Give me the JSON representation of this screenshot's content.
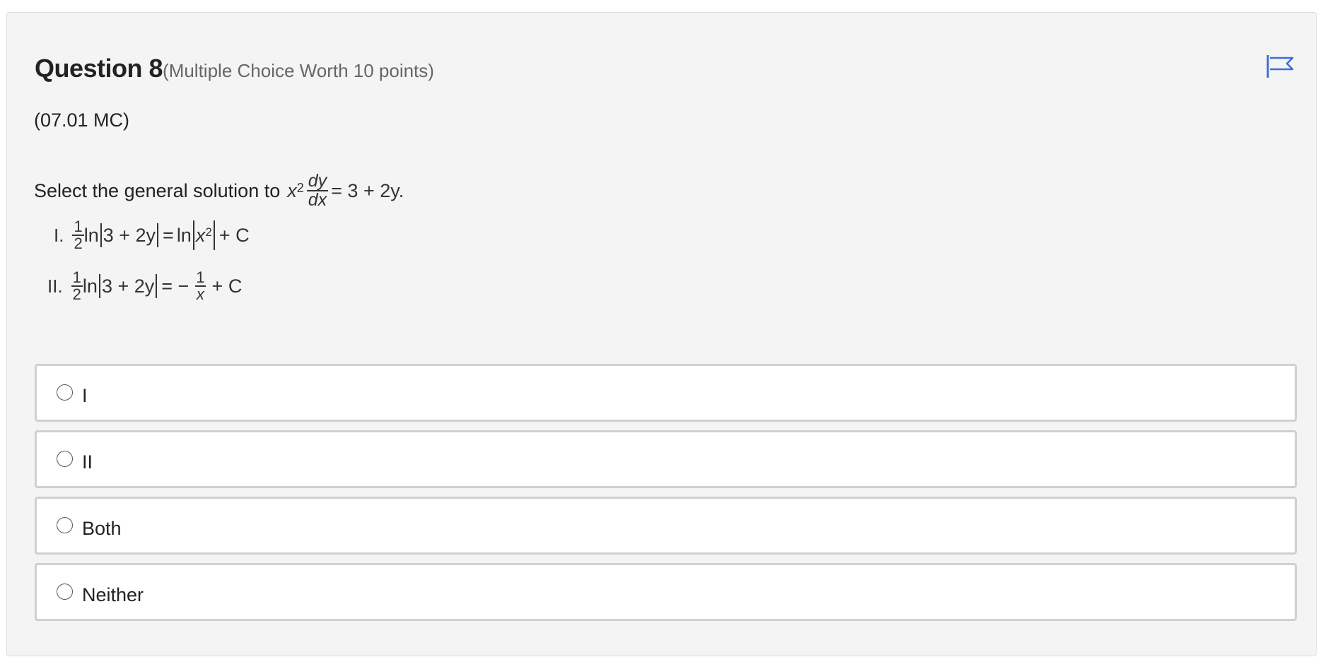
{
  "question": {
    "title": "Question 8",
    "meta": "(Multiple Choice Worth 10 points)",
    "code": "(07.01 MC)",
    "prompt": "Select the general solution to",
    "flag_icon": "flag-icon",
    "equation": {
      "base": "x",
      "exponent": "2",
      "frac_num": "dy",
      "frac_den": "dx",
      "rhs": "= 3 + 2y."
    }
  },
  "statements": [
    {
      "label": "I.",
      "coef_num": "1",
      "coef_den": "2",
      "ln_left": "ln",
      "abs_left": "3 + 2y",
      "equals": "=",
      "ln_right": "ln",
      "abs_right_base": "x",
      "abs_right_exp": "2",
      "tail": "+ C"
    },
    {
      "label": "II.",
      "coef_num": "1",
      "coef_den": "2",
      "ln_left": "ln",
      "abs_left": "3 + 2y",
      "equals": "= −",
      "frac_num": "1",
      "frac_den": "x",
      "tail": "+ C"
    }
  ],
  "options": [
    {
      "label": "I",
      "selected": false
    },
    {
      "label": "II",
      "selected": false
    },
    {
      "label": "Both",
      "selected": false
    },
    {
      "label": "Neither",
      "selected": false
    }
  ],
  "colors": {
    "flag": "#3b6fd4",
    "card_bg": "#f4f4f4",
    "option_border": "#d0d0d0"
  }
}
